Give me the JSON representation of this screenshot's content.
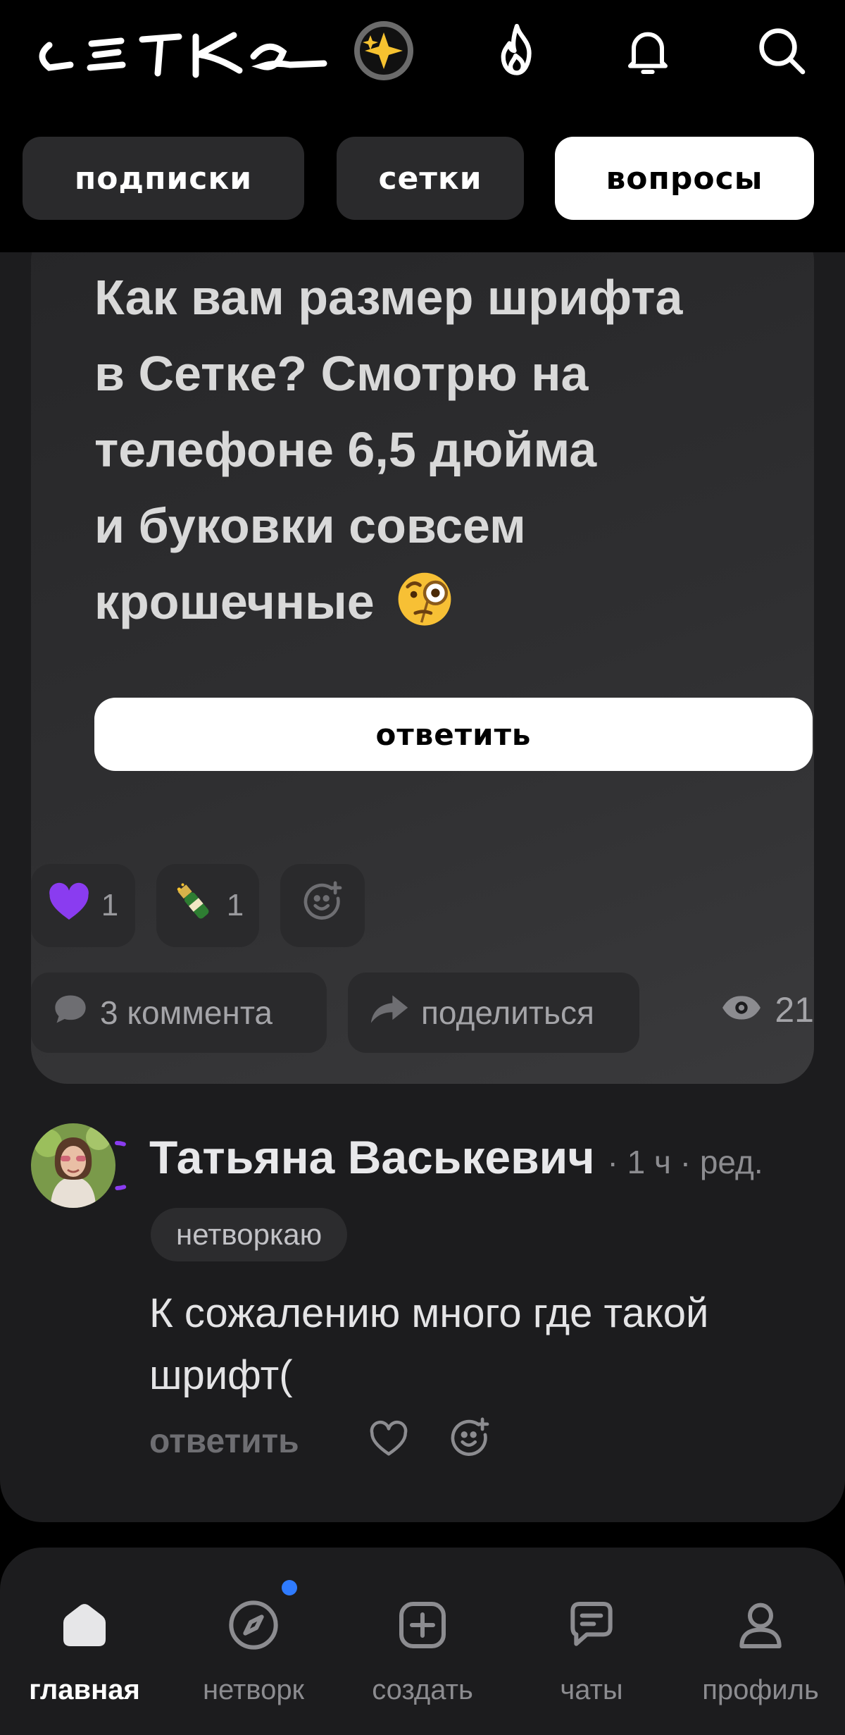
{
  "header": {
    "logo_text": "сетка",
    "icons": [
      "sparkle-icon",
      "fire-icon",
      "bell-icon",
      "search-icon"
    ]
  },
  "tabs": [
    {
      "label": "подписки",
      "active": false
    },
    {
      "label": "сетки",
      "active": false
    },
    {
      "label": "вопросы",
      "active": true
    }
  ],
  "question": {
    "lines": [
      "Как вам размер шрифта",
      "в Сетке? Смотрю на",
      "телефоне 6,5 дюйма",
      "и буковки совсем",
      "крошечные"
    ],
    "emoji": "face-with-monocle-emoji",
    "answer_button": "ответить"
  },
  "reactions": [
    {
      "icon": "purple-heart-emoji",
      "count": "1"
    },
    {
      "icon": "champagne-emoji",
      "count": "1"
    }
  ],
  "actions": {
    "comments_label": "3 коммента",
    "share_label": "поделиться",
    "views_count": "21"
  },
  "comment": {
    "author": "Татьяна Васькевич",
    "meta": "· 1 ч · ред.",
    "badge": "нетворкаю",
    "text_lines": [
      "К сожалению много где такой",
      "шрифт("
    ],
    "reply_label": "ответить"
  },
  "nav": [
    {
      "label": "главная",
      "icon": "home-icon",
      "active": true
    },
    {
      "label": "нетворк",
      "icon": "compass-icon",
      "active": false,
      "has_dot": true
    },
    {
      "label": "создать",
      "icon": "plus-square-icon",
      "active": false
    },
    {
      "label": "чаты",
      "icon": "chat-icon",
      "active": false
    },
    {
      "label": "профиль",
      "icon": "profile-icon",
      "active": false
    }
  ],
  "colors": {
    "background": "#000000",
    "card": "#1c1c1e",
    "chip": "#2a2a2c",
    "accent_dot": "#2f7bff",
    "heart": "#8a3cf0"
  }
}
